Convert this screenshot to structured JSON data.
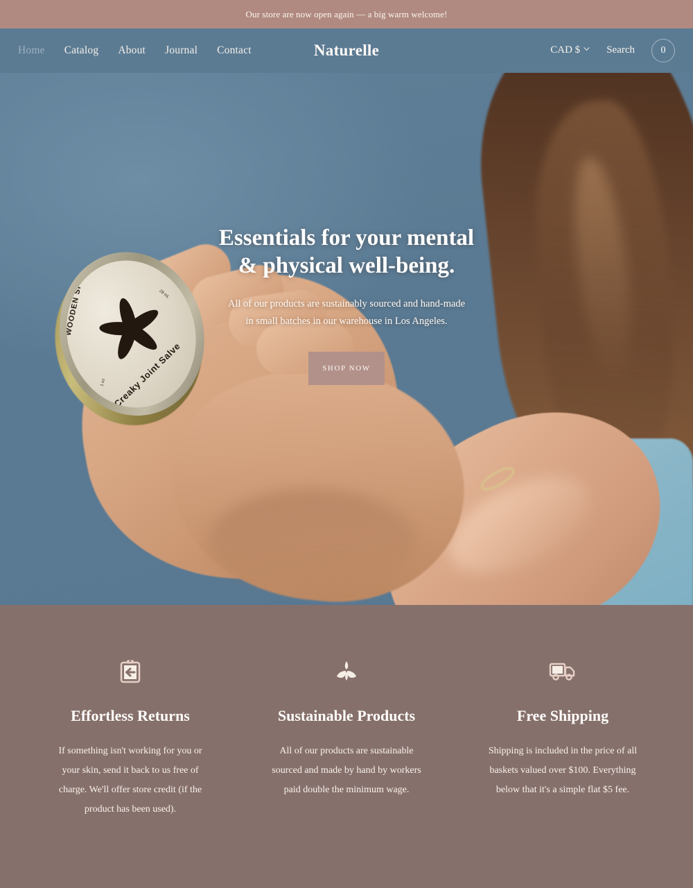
{
  "announcement": {
    "text": "Our store are now open again — a big warm welcome!"
  },
  "header": {
    "logo": "Naturelle",
    "nav": [
      {
        "label": "Home",
        "active": true
      },
      {
        "label": "Catalog",
        "active": false
      },
      {
        "label": "About",
        "active": false
      },
      {
        "label": "Journal",
        "active": false
      },
      {
        "label": "Contact",
        "active": false
      }
    ],
    "currency": {
      "label": "CAD $",
      "icon": "chevron-down-icon"
    },
    "search_label": "Search",
    "cart_count": "0"
  },
  "hero": {
    "title_line1": "Essentials for your mental",
    "title_line2": "& physical well-being.",
    "subtitle_line1": "All of our products are sustainably sourced and hand-made",
    "subtitle_line2": "in small batches in our warehouse in Los Angeles.",
    "cta_label": "SHOP NOW",
    "product": {
      "brand": "WOODEN SPOON HERBS",
      "name": "Creaky Joint Salve",
      "size_left": "1 oz",
      "size_right": "28 mL"
    }
  },
  "features": [
    {
      "icon": "return-clipboard-icon",
      "title": "Effortless Returns",
      "body": "If something isn't working for you or your skin, send it back to us free of charge. We'll offer store credit (if the product has been used)."
    },
    {
      "icon": "lotus-icon",
      "title": "Sustainable Products",
      "body": "All of our products are sustainable sourced and made by hand by workers paid double the minimum wage."
    },
    {
      "icon": "delivery-truck-icon",
      "title": "Free Shipping",
      "body": "Shipping is included in the price of all baskets valued over $100. Everything below that it's a simple flat $5 fee."
    }
  ],
  "colors": {
    "announcement_bg": "#b08a80",
    "header_bg": "#5b7b93",
    "hero_sky": "#5a7a93",
    "features_bg": "#86706b",
    "cta_bg": "#b2918a",
    "icon_color": "#f3e4dc"
  }
}
